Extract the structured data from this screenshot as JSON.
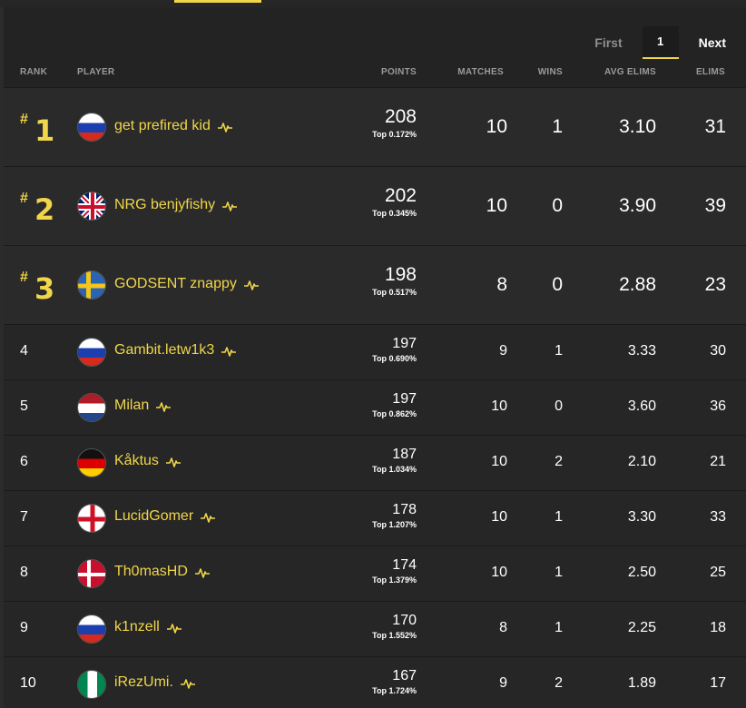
{
  "pagination": {
    "first": "First",
    "current": "1",
    "next": "Next"
  },
  "headers": {
    "rank": "RANK",
    "player": "PLAYER",
    "points": "POINTS",
    "matches": "MATCHES",
    "wins": "WINS",
    "avg_elims": "AVG ELIMS",
    "elims": "ELIMS"
  },
  "rows": [
    {
      "rank": "1",
      "flag": "flag-russia-icon",
      "player": "get prefired kid",
      "points": "208",
      "top": "Top 0.172%",
      "matches": "10",
      "wins": "1",
      "avg_elims": "3.10",
      "elims": "31"
    },
    {
      "rank": "2",
      "flag": "flag-uk-icon",
      "player": "NRG benjyfishy",
      "points": "202",
      "top": "Top 0.345%",
      "matches": "10",
      "wins": "0",
      "avg_elims": "3.90",
      "elims": "39"
    },
    {
      "rank": "3",
      "flag": "flag-sweden-icon",
      "player": "GODSENT znappy",
      "points": "198",
      "top": "Top 0.517%",
      "matches": "8",
      "wins": "0",
      "avg_elims": "2.88",
      "elims": "23"
    },
    {
      "rank": "4",
      "flag": "flag-russia-icon",
      "player": "Gambit.letw1k3",
      "points": "197",
      "top": "Top 0.690%",
      "matches": "9",
      "wins": "1",
      "avg_elims": "3.33",
      "elims": "30"
    },
    {
      "rank": "5",
      "flag": "flag-netherlands-icon",
      "player": "Milan",
      "points": "197",
      "top": "Top 0.862%",
      "matches": "10",
      "wins": "0",
      "avg_elims": "3.60",
      "elims": "36"
    },
    {
      "rank": "6",
      "flag": "flag-germany-icon",
      "player": "Kåktus",
      "points": "187",
      "top": "Top 1.034%",
      "matches": "10",
      "wins": "2",
      "avg_elims": "2.10",
      "elims": "21"
    },
    {
      "rank": "7",
      "flag": "flag-england-icon",
      "player": "LucidGomer",
      "points": "178",
      "top": "Top 1.207%",
      "matches": "10",
      "wins": "1",
      "avg_elims": "3.30",
      "elims": "33"
    },
    {
      "rank": "8",
      "flag": "flag-denmark-icon",
      "player": "Th0masHD",
      "points": "174",
      "top": "Top 1.379%",
      "matches": "10",
      "wins": "1",
      "avg_elims": "2.50",
      "elims": "25"
    },
    {
      "rank": "9",
      "flag": "flag-russia-icon",
      "player": "k1nzell",
      "points": "170",
      "top": "Top 1.552%",
      "matches": "8",
      "wins": "1",
      "avg_elims": "2.25",
      "elims": "18"
    },
    {
      "rank": "10",
      "flag": "flag-nigeria-icon",
      "player": "iRezUmi.",
      "points": "167",
      "top": "Top 1.724%",
      "matches": "9",
      "wins": "2",
      "avg_elims": "1.89",
      "elims": "17"
    }
  ],
  "colors": {
    "accent": "#f0d64a",
    "background": "#232323",
    "row_top": "#2a2a2a",
    "row_regular": "#262626"
  }
}
